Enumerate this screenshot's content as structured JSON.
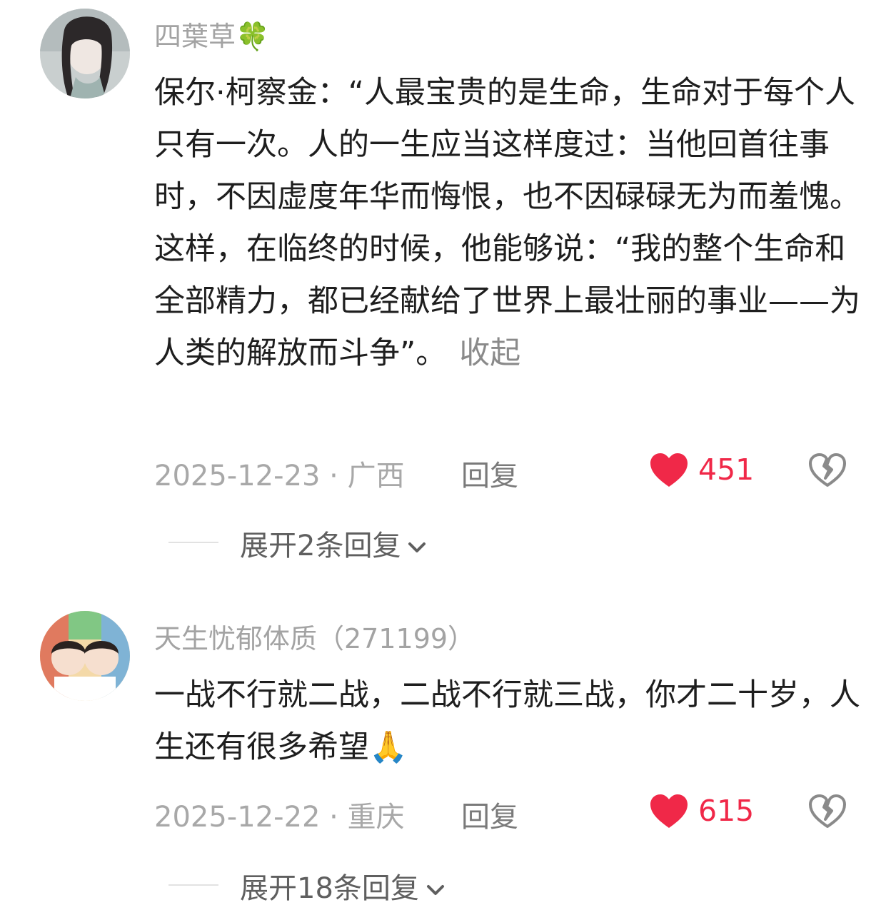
{
  "comments": [
    {
      "username": "四葉草",
      "username_emoji": "🍀",
      "text": "保尔·柯察金：“人最宝贵的是生命，生命对于每个人只有一次。人的一生应当这样度过：当他回首往事时，不因虚度年华而悔恨，也不因碌碌无为而羞愧。这样，在临终的时候，他能够说：“我的整个生命和全部精力，都已经献给了世界上最壮丽的事业——为人类的解放而斗争”。",
      "collapse_label": "收起",
      "date_location": "2025-12-23 · 广西",
      "reply_label": "回复",
      "likes": "451",
      "like_icon": "heart-filled-icon",
      "dislike_icon": "broken-heart-icon",
      "expand_label": "展开2条回复"
    },
    {
      "username": "天生忧郁体质（271199）",
      "text": "一战不行就二战，二战不行就三战，你才二十岁，人生还有很多希望🙏",
      "date_location": "2025-12-22 · 重庆",
      "reply_label": "回复",
      "likes": "615",
      "like_icon": "heart-filled-icon",
      "dislike_icon": "broken-heart-icon",
      "expand_label": "展开18条回复"
    }
  ],
  "colors": {
    "like": "#f02848",
    "username": "#a3a3a3",
    "text": "#1e1e1e",
    "meta": "#a8a8a8"
  }
}
